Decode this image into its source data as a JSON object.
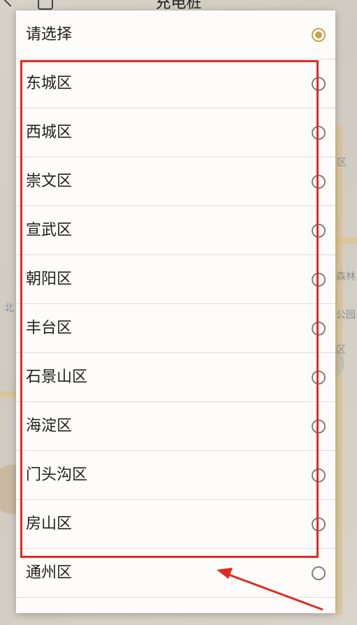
{
  "header": {
    "title": "充电桩"
  },
  "dialog": {
    "options": [
      {
        "label": "请选择",
        "checked": true
      },
      {
        "label": "东城区",
        "checked": false
      },
      {
        "label": "西城区",
        "checked": false
      },
      {
        "label": "崇文区",
        "checked": false
      },
      {
        "label": "宣武区",
        "checked": false
      },
      {
        "label": "朝阳区",
        "checked": false
      },
      {
        "label": "丰台区",
        "checked": false
      },
      {
        "label": "石景山区",
        "checked": false
      },
      {
        "label": "海淀区",
        "checked": false
      },
      {
        "label": "门头沟区",
        "checked": false
      },
      {
        "label": "房山区",
        "checked": false
      },
      {
        "label": "通州区",
        "checked": false
      }
    ]
  },
  "map_labels": [
    "区",
    "北",
    "公园",
    "森林",
    "区"
  ],
  "colors": {
    "accent": "#c8a24a",
    "annotation": "#e02a22"
  }
}
